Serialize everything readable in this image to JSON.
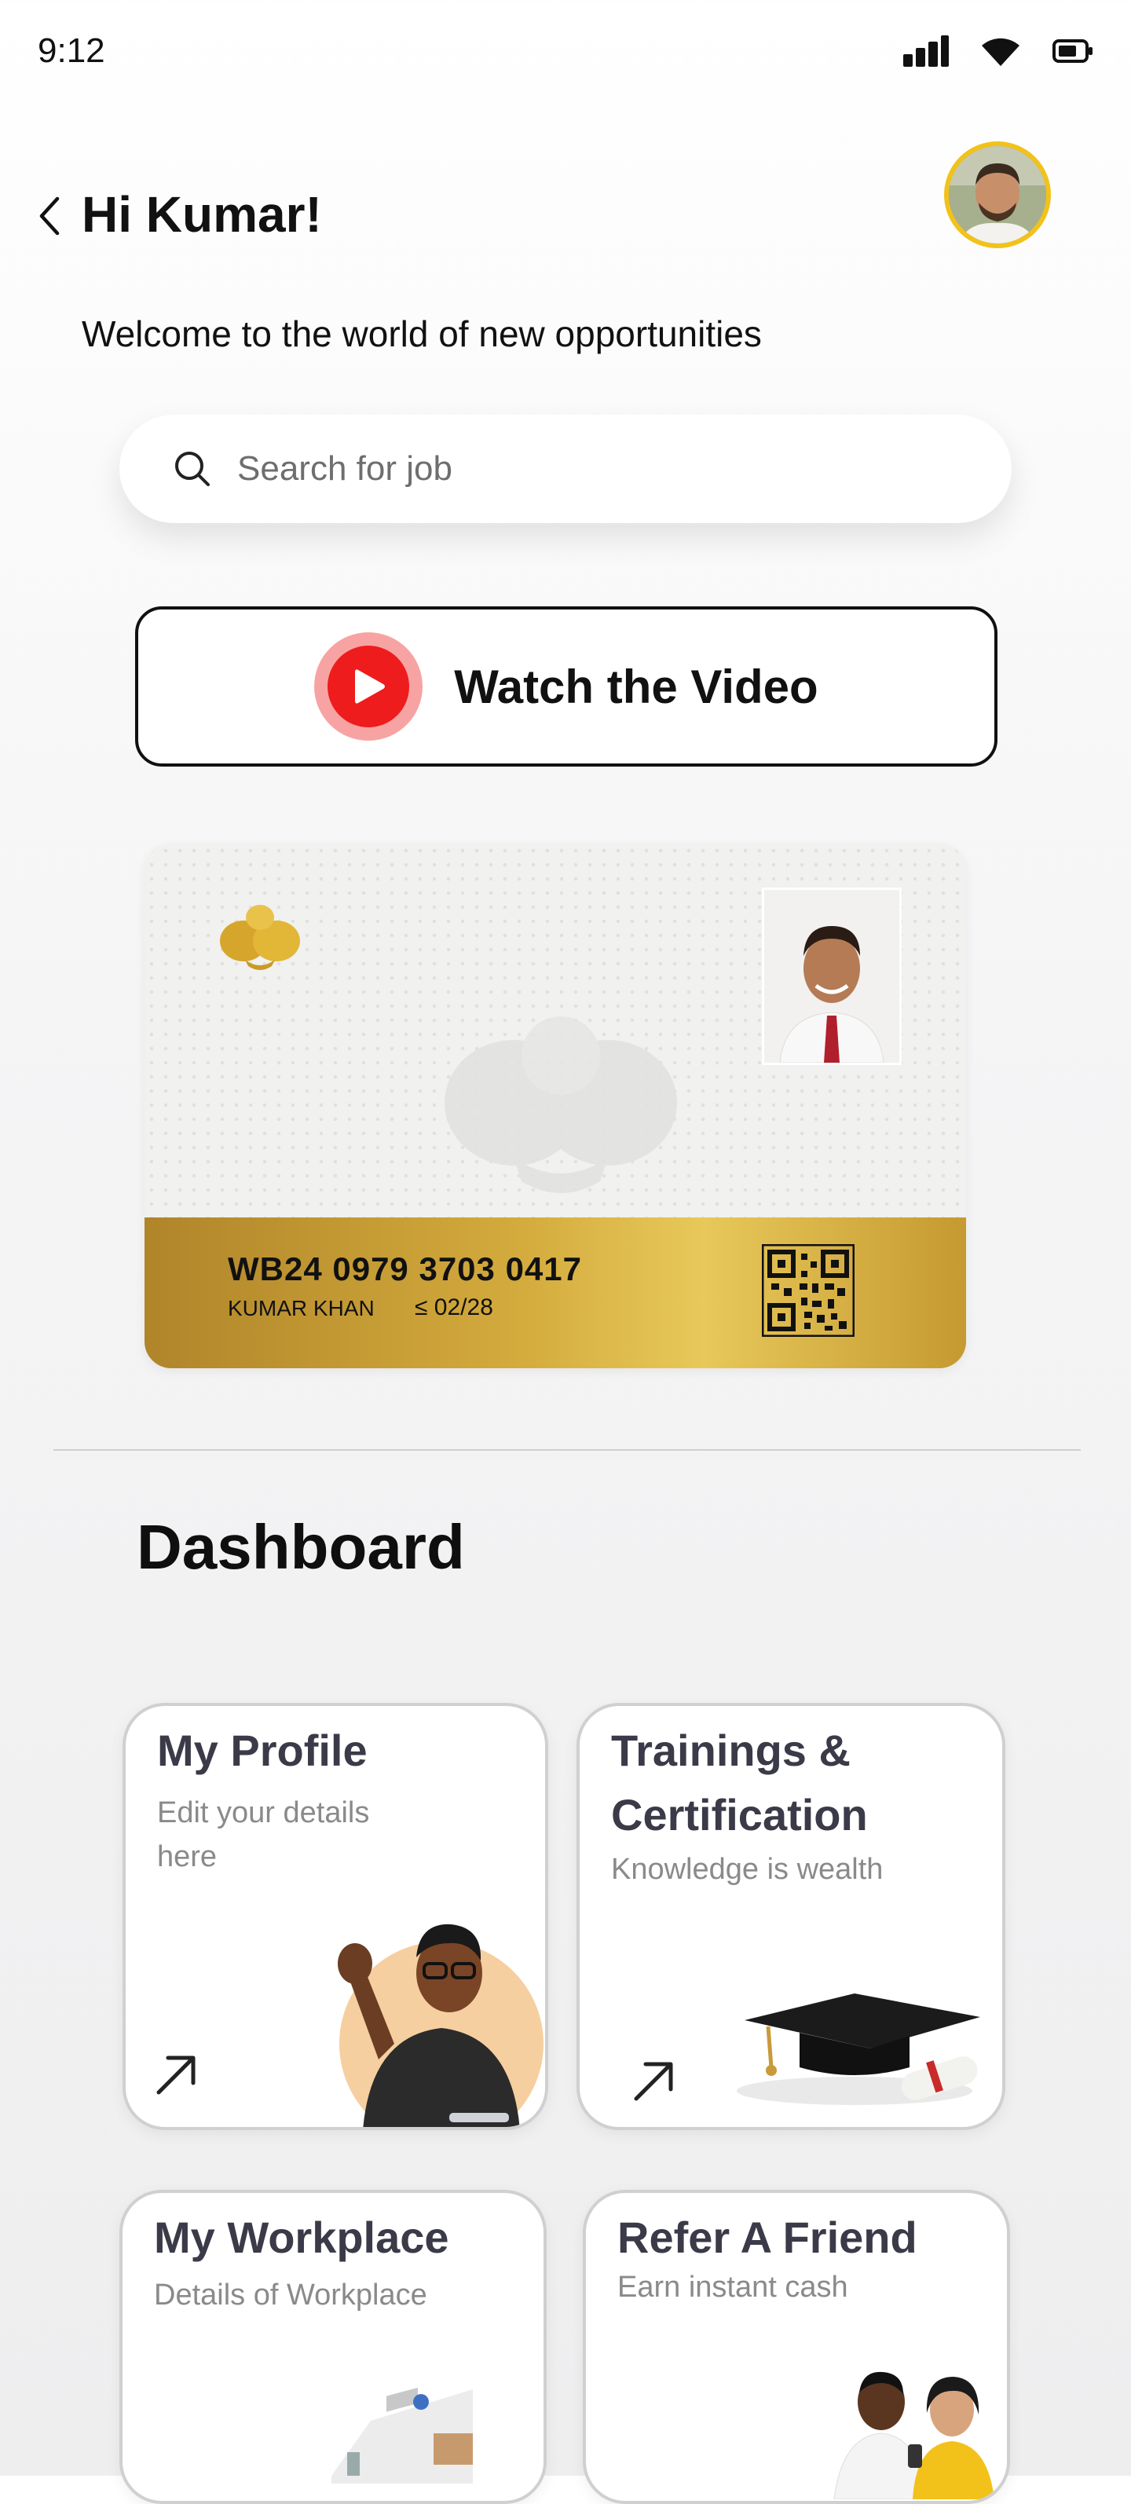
{
  "status_bar": {
    "time": "9:12"
  },
  "header": {
    "greeting": "Hi Kumar!",
    "subtitle": "Welcome to the world of new opportunities"
  },
  "search": {
    "placeholder": "Search for job"
  },
  "watch_video": {
    "label": "Watch the Video"
  },
  "id_card": {
    "number": "WB24 0979 3703 0417",
    "name": "KUMAR KHAN",
    "expiry": "≤ 02/28"
  },
  "dashboard": {
    "title": "Dashboard",
    "tiles": [
      {
        "title": "My Profile",
        "subtitle_1": "Edit your details",
        "subtitle_2": "here"
      },
      {
        "title_1": "Trainings &",
        "title_2": "Certification",
        "subtitle": "Knowledge is wealth"
      },
      {
        "title": "My Workplace",
        "subtitle": "Details of Workplace"
      },
      {
        "title": "Refer A Friend",
        "subtitle": "Earn instant cash"
      }
    ]
  },
  "colors": {
    "accent_gold": "#d3aa3c",
    "play_red": "#ee1c1c",
    "avatar_ring": "#f2c21b",
    "tile_title": "#3a3a48"
  }
}
